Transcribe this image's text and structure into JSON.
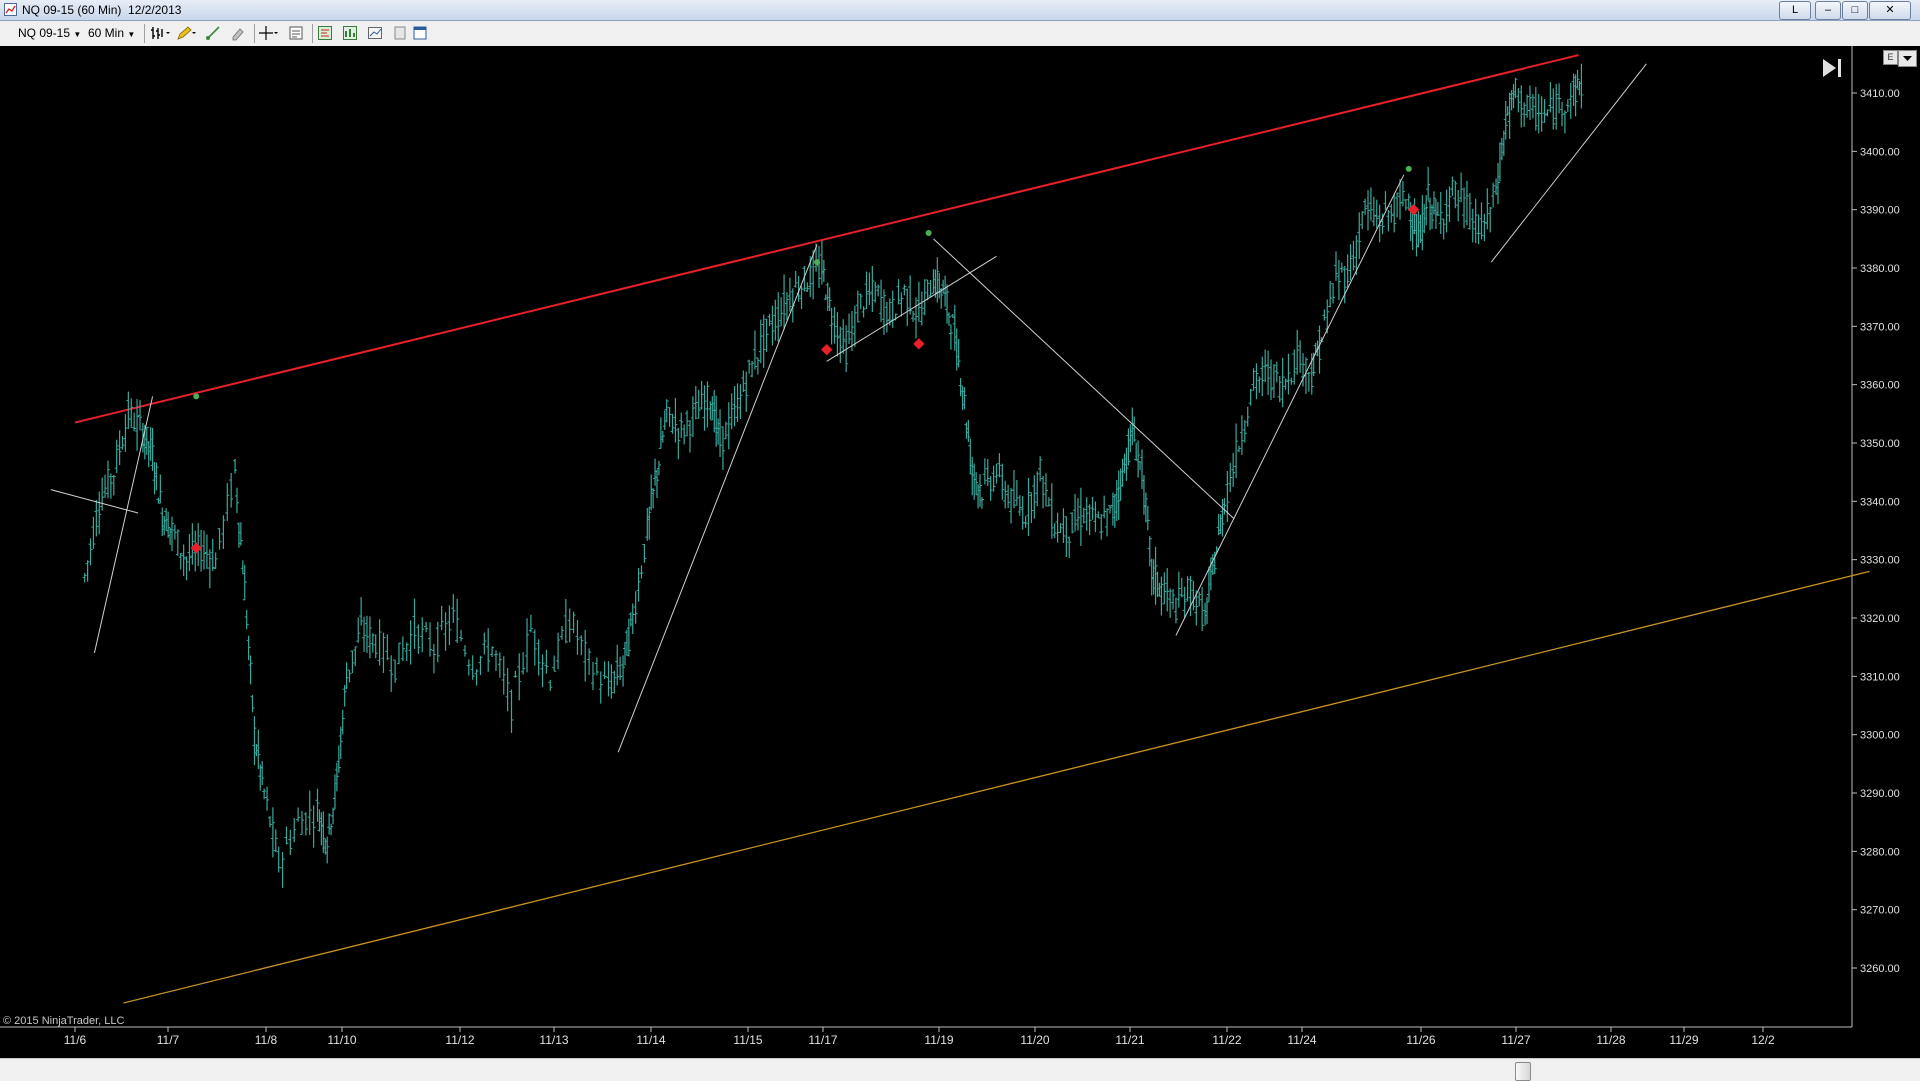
{
  "window": {
    "title": "NQ 09-15 (60 Min)  12/2/2013",
    "tab_label": "L",
    "minimize": "–",
    "maximize": "□",
    "close": "✕"
  },
  "toolbar": {
    "instrument": "NQ 09-15",
    "interval": "60 Min",
    "icons": [
      "bar-type-icon",
      "drawing-pencil-icon",
      "draw-line-icon",
      "eraser-icon",
      "crosshair-icon",
      "properties-icon",
      "data-box-icon",
      "strategies-icon",
      "chart-trader-icon",
      "template-icon",
      "window-icon"
    ]
  },
  "copyright": "© 2015 NinjaTrader, LLC",
  "panel_button": "E",
  "chart_data": {
    "type": "bar",
    "instrument": "NQ 09-15",
    "interval": "60 Min",
    "background": "#000000",
    "bar_color": "#3aa89c",
    "price_axis": {
      "ticks": [
        "3410.00",
        "3400.00",
        "3390.00",
        "3380.00",
        "3370.00",
        "3360.00",
        "3350.00",
        "3340.00",
        "3330.00",
        "3320.00",
        "3310.00",
        "3300.00",
        "3290.00",
        "3280.00",
        "3270.00",
        "3260.00"
      ],
      "range": [
        3254,
        3418
      ]
    },
    "date_axis": {
      "ticks": [
        "11/6",
        "11/7",
        "11/8",
        "11/10",
        "11/12",
        "11/13",
        "11/14",
        "11/15",
        "11/17",
        "11/19",
        "11/20",
        "11/21",
        "11/22",
        "11/24",
        "11/26",
        "11/27",
        "11/28",
        "11/29",
        "12/2"
      ]
    },
    "series": [
      {
        "values": [
          {
            "d": 0.2,
            "c": 3327
          },
          {
            "d": 0.5,
            "c": 3340
          },
          {
            "d": 0.8,
            "c": 3345
          },
          {
            "d": 1.1,
            "c": 3355
          },
          {
            "d": 1.4,
            "c": 3352
          },
          {
            "d": 1.6,
            "c": 3348
          },
          {
            "d": 1.8,
            "c": 3338
          },
          {
            "d": 2.0,
            "c": 3335
          },
          {
            "d": 2.3,
            "c": 3330
          },
          {
            "d": 2.6,
            "c": 3332
          },
          {
            "d": 2.9,
            "c": 3330
          },
          {
            "d": 3.3,
            "c": 3345
          },
          {
            "d": 3.5,
            "c": 3325
          },
          {
            "d": 3.7,
            "c": 3300
          },
          {
            "d": 3.9,
            "c": 3290
          },
          {
            "d": 4.2,
            "c": 3278
          },
          {
            "d": 4.6,
            "c": 3285
          },
          {
            "d": 5.0,
            "c": 3287
          },
          {
            "d": 5.2,
            "c": 3282
          },
          {
            "d": 5.4,
            "c": 3292
          },
          {
            "d": 5.6,
            "c": 3310
          },
          {
            "d": 5.9,
            "c": 3318
          },
          {
            "d": 6.2,
            "c": 3316
          },
          {
            "d": 6.6,
            "c": 3312
          },
          {
            "d": 7.0,
            "c": 3318
          },
          {
            "d": 7.4,
            "c": 3315
          },
          {
            "d": 7.8,
            "c": 3320
          },
          {
            "d": 8.2,
            "c": 3312
          },
          {
            "d": 8.6,
            "c": 3315
          },
          {
            "d": 9.0,
            "c": 3305
          },
          {
            "d": 9.4,
            "c": 3318
          },
          {
            "d": 9.8,
            "c": 3310
          },
          {
            "d": 10.2,
            "c": 3320
          },
          {
            "d": 10.6,
            "c": 3312
          },
          {
            "d": 11.0,
            "c": 3308
          },
          {
            "d": 11.3,
            "c": 3312
          },
          {
            "d": 11.5,
            "c": 3320
          },
          {
            "d": 11.8,
            "c": 3335
          },
          {
            "d": 12.0,
            "c": 3345
          },
          {
            "d": 12.2,
            "c": 3355
          },
          {
            "d": 12.5,
            "c": 3352
          },
          {
            "d": 12.8,
            "c": 3355
          },
          {
            "d": 13.1,
            "c": 3358
          },
          {
            "d": 13.3,
            "c": 3350
          },
          {
            "d": 13.6,
            "c": 3355
          },
          {
            "d": 13.9,
            "c": 3362
          },
          {
            "d": 14.2,
            "c": 3368
          },
          {
            "d": 14.5,
            "c": 3372
          },
          {
            "d": 14.8,
            "c": 3376
          },
          {
            "d": 15.1,
            "c": 3378
          },
          {
            "d": 15.4,
            "c": 3380
          },
          {
            "d": 15.6,
            "c": 3372
          },
          {
            "d": 15.9,
            "c": 3366
          },
          {
            "d": 16.2,
            "c": 3374
          },
          {
            "d": 16.5,
            "c": 3376
          },
          {
            "d": 16.8,
            "c": 3372
          },
          {
            "d": 17.1,
            "c": 3376
          },
          {
            "d": 17.4,
            "c": 3372
          },
          {
            "d": 17.7,
            "c": 3378
          },
          {
            "d": 17.9,
            "c": 3376
          },
          {
            "d": 18.1,
            "c": 3370
          },
          {
            "d": 18.3,
            "c": 3360
          },
          {
            "d": 18.5,
            "c": 3345
          },
          {
            "d": 18.7,
            "c": 3342
          },
          {
            "d": 19.0,
            "c": 3345
          },
          {
            "d": 19.3,
            "c": 3340
          },
          {
            "d": 19.6,
            "c": 3338
          },
          {
            "d": 19.9,
            "c": 3345
          },
          {
            "d": 20.2,
            "c": 3336
          },
          {
            "d": 20.5,
            "c": 3335
          },
          {
            "d": 20.8,
            "c": 3338
          },
          {
            "d": 21.1,
            "c": 3336
          },
          {
            "d": 21.4,
            "c": 3338
          },
          {
            "d": 21.6,
            "c": 3345
          },
          {
            "d": 21.8,
            "c": 3352
          },
          {
            "d": 22.0,
            "c": 3345
          },
          {
            "d": 22.2,
            "c": 3328
          },
          {
            "d": 22.4,
            "c": 3325
          },
          {
            "d": 22.7,
            "c": 3322
          },
          {
            "d": 23.0,
            "c": 3325
          },
          {
            "d": 23.3,
            "c": 3320
          },
          {
            "d": 23.5,
            "c": 3330
          },
          {
            "d": 23.7,
            "c": 3340
          },
          {
            "d": 24.0,
            "c": 3350
          },
          {
            "d": 24.3,
            "c": 3360
          },
          {
            "d": 24.6,
            "c": 3362
          },
          {
            "d": 24.9,
            "c": 3360
          },
          {
            "d": 25.2,
            "c": 3365
          },
          {
            "d": 25.5,
            "c": 3362
          },
          {
            "d": 25.7,
            "c": 3368
          },
          {
            "d": 26.0,
            "c": 3378
          },
          {
            "d": 26.3,
            "c": 3380
          },
          {
            "d": 26.6,
            "c": 3390
          },
          {
            "d": 26.9,
            "c": 3388
          },
          {
            "d": 27.2,
            "c": 3390
          },
          {
            "d": 27.5,
            "c": 3392
          },
          {
            "d": 27.7,
            "c": 3384
          },
          {
            "d": 27.9,
            "c": 3392
          },
          {
            "d": 28.1,
            "c": 3388
          },
          {
            "d": 28.4,
            "c": 3393
          },
          {
            "d": 28.7,
            "c": 3390
          },
          {
            "d": 29.0,
            "c": 3386
          },
          {
            "d": 29.3,
            "c": 3393
          },
          {
            "d": 29.5,
            "c": 3405
          },
          {
            "d": 29.7,
            "c": 3410
          },
          {
            "d": 30.0,
            "c": 3407
          },
          {
            "d": 30.3,
            "c": 3406
          },
          {
            "d": 30.6,
            "c": 3408
          },
          {
            "d": 30.9,
            "c": 3410
          },
          {
            "d": 31.1,
            "c": 3412
          }
        ]
      }
    ],
    "colors": {
      "upper_channel": "#e8202a",
      "lower_channel": "#c8931e",
      "trendline": "#d0d0d0",
      "buy_marker": "#4cb050",
      "sell_marker": "#e8202a"
    },
    "upper_channel": [
      {
        "d": 0.0,
        "p": 3353.5
      },
      {
        "d": 31.0,
        "p": 3416.5
      }
    ],
    "lower_channel": [
      {
        "d": 1.0,
        "p": 3254
      },
      {
        "d": 37.0,
        "p": 3328
      }
    ],
    "trendlines": [
      [
        {
          "d": -0.5,
          "p": 3342
        },
        {
          "d": 1.3,
          "p": 3338
        }
      ],
      [
        {
          "d": 0.4,
          "p": 3314
        },
        {
          "d": 1.6,
          "p": 3358
        }
      ],
      [
        {
          "d": 11.2,
          "p": 3297
        },
        {
          "d": 15.3,
          "p": 3384
        }
      ],
      [
        {
          "d": 15.5,
          "p": 3364
        },
        {
          "d": 19.0,
          "p": 3382
        }
      ],
      [
        {
          "d": 17.7,
          "p": 3385
        },
        {
          "d": 23.9,
          "p": 3337
        }
      ],
      [
        {
          "d": 22.7,
          "p": 3317
        },
        {
          "d": 27.4,
          "p": 3396
        }
      ],
      [
        {
          "d": 29.2,
          "p": 3381
        },
        {
          "d": 32.4,
          "p": 3415
        }
      ]
    ],
    "markers": [
      {
        "type": "buy",
        "d": 2.5,
        "p": 3358
      },
      {
        "type": "sell",
        "d": 2.5,
        "p": 3332
      },
      {
        "type": "buy",
        "d": 15.3,
        "p": 3381
      },
      {
        "type": "sell",
        "d": 15.5,
        "p": 3366
      },
      {
        "type": "buy",
        "d": 17.6,
        "p": 3386
      },
      {
        "type": "sell",
        "d": 17.4,
        "p": 3367
      },
      {
        "type": "buy",
        "d": 27.5,
        "p": 3397
      },
      {
        "type": "sell",
        "d": 27.6,
        "p": 3390
      }
    ]
  }
}
